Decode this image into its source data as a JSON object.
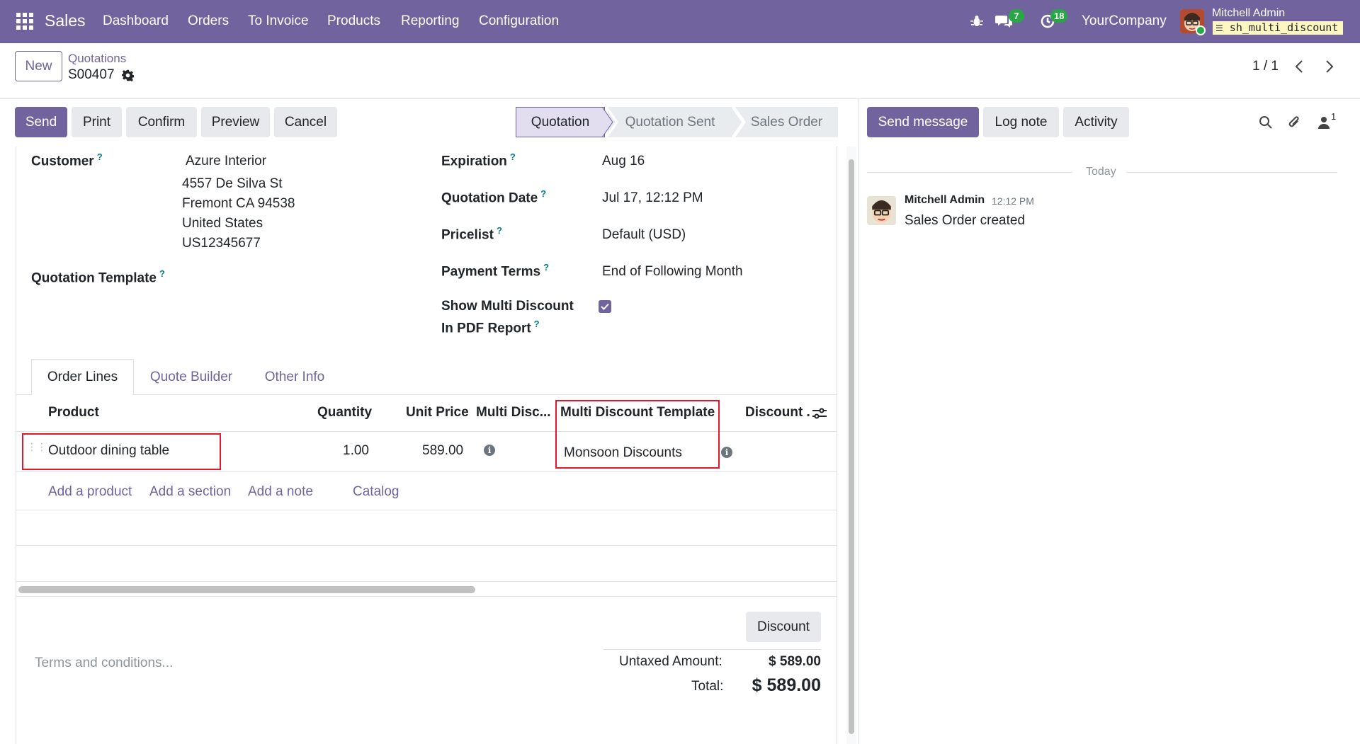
{
  "navbar": {
    "app_name": "Sales",
    "menu": [
      "Dashboard",
      "Orders",
      "To Invoice",
      "Products",
      "Reporting",
      "Configuration"
    ],
    "messages_count": "7",
    "activities_count": "18",
    "company": "YourCompany",
    "user_name": "Mitchell Admin",
    "db_name": "sh_multi_discount"
  },
  "control": {
    "new_label": "New",
    "breadcrumb_parent": "Quotations",
    "record_name": "S00407",
    "pager": "1 / 1"
  },
  "actions": {
    "send": "Send",
    "print": "Print",
    "confirm": "Confirm",
    "preview": "Preview",
    "cancel": "Cancel"
  },
  "status": {
    "stages": [
      "Quotation",
      "Quotation Sent",
      "Sales Order"
    ],
    "active": "Quotation"
  },
  "form": {
    "customer_label": "Customer",
    "customer_name": "Azure Interior",
    "customer_address": [
      "4557 De Silva St",
      "Fremont CA 94538",
      "United States",
      "US12345677"
    ],
    "template_label": "Quotation Template",
    "expiration_label": "Expiration",
    "expiration_value": "Aug 16",
    "qdate_label": "Quotation Date",
    "qdate_value": "Jul 17, 12:12 PM",
    "pricelist_label": "Pricelist",
    "pricelist_value": "Default (USD)",
    "terms_label": "Payment Terms",
    "terms_value": "End of Following Month",
    "show_md_label_1": "Show Multi Discount",
    "show_md_label_2": "In PDF Report",
    "show_md_checked": true
  },
  "tabs": [
    "Order Lines",
    "Quote Builder",
    "Other Info"
  ],
  "table": {
    "headers": {
      "product": "Product",
      "quantity": "Quantity",
      "unit_price": "Unit Price",
      "multi_disc": "Multi Disc...",
      "md_template": "Multi Discount Template",
      "discount": "Discount ."
    },
    "rows": [
      {
        "product": "Outdoor dining table",
        "quantity": "1.00",
        "unit_price": "589.00",
        "md_template": "Monsoon Discounts",
        "discount": ""
      }
    ],
    "add_links": [
      "Add a product",
      "Add a section",
      "Add a note",
      "Catalog"
    ]
  },
  "footer": {
    "terms_placeholder": "Terms and conditions...",
    "discount_button": "Discount",
    "untaxed_label": "Untaxed Amount:",
    "untaxed_value": "$ 589.00",
    "total_label": "Total:",
    "total_value": "$ 589.00"
  },
  "chatter": {
    "send_message": "Send message",
    "log_note": "Log note",
    "activity": "Activity",
    "followers_count": "1",
    "date_separator": "Today",
    "messages": [
      {
        "author": "Mitchell Admin",
        "time": "12:12 PM",
        "body": "Sales Order created"
      }
    ]
  },
  "colors": {
    "brand": "#71639e",
    "badge": "#28a745",
    "highlight_box": "#e5162f",
    "link": "#71639e"
  }
}
